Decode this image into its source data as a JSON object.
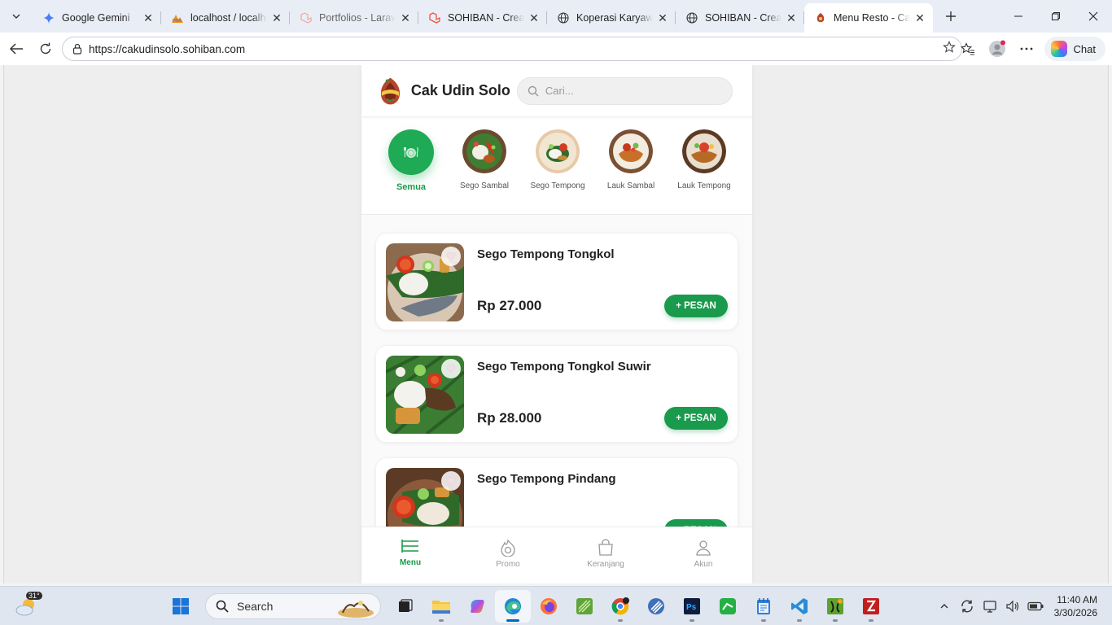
{
  "browser": {
    "tabs": [
      {
        "title": "Google Gemini",
        "icon": "gemini-icon",
        "color": "#4285f4"
      },
      {
        "title": "localhost / localhost",
        "icon": "phpmyadmin-icon",
        "color": "#f29111"
      },
      {
        "title": "Portfolios - Laravel",
        "icon": "laravel-icon",
        "color": "#f05340"
      },
      {
        "title": "SOHIBAN - Creative",
        "icon": "laravel-icon",
        "color": "#f05340"
      },
      {
        "title": "Koperasi Karyawan",
        "icon": "globe-icon",
        "color": "#333333"
      },
      {
        "title": "SOHIBAN - Creative",
        "icon": "globe-icon",
        "color": "#333333"
      },
      {
        "title": "Menu Resto - Cak Udin",
        "icon": "resto-icon",
        "color": "#b8452a"
      }
    ],
    "active_tab": 6,
    "url": "https://cakudinsolo.sohiban.com",
    "chat_label": "Chat"
  },
  "app": {
    "brand": "Cak Udin Solo",
    "search_placeholder": "Cari...",
    "accent_color": "#1a9a4c",
    "categories": [
      {
        "label": "Semua",
        "active": true
      },
      {
        "label": "Sego Sambal",
        "active": false
      },
      {
        "label": "Sego Tempong",
        "active": false
      },
      {
        "label": "Lauk Sambal",
        "active": false
      },
      {
        "label": "Lauk Tempong",
        "active": false
      }
    ],
    "products": [
      {
        "name": "Sego Tempong Tongkol",
        "price": "Rp 27.000",
        "order_label": "+ PESAN"
      },
      {
        "name": "Sego Tempong Tongkol Suwir",
        "price": "Rp 28.000",
        "order_label": "+ PESAN"
      },
      {
        "name": "Sego Tempong Pindang",
        "price": "",
        "order_label": "+ PESAN"
      }
    ],
    "bottom_nav": [
      {
        "label": "Menu",
        "icon": "menu-list-icon",
        "active": true
      },
      {
        "label": "Promo",
        "icon": "promo-icon",
        "active": false
      },
      {
        "label": "Keranjang",
        "icon": "shopping-bag-icon",
        "active": false
      },
      {
        "label": "Akun",
        "icon": "user-icon",
        "active": false
      }
    ]
  },
  "taskbar": {
    "weather_temp": "31°",
    "search_label": "Search",
    "time": "11:40 AM",
    "date": "3/30/2026"
  }
}
